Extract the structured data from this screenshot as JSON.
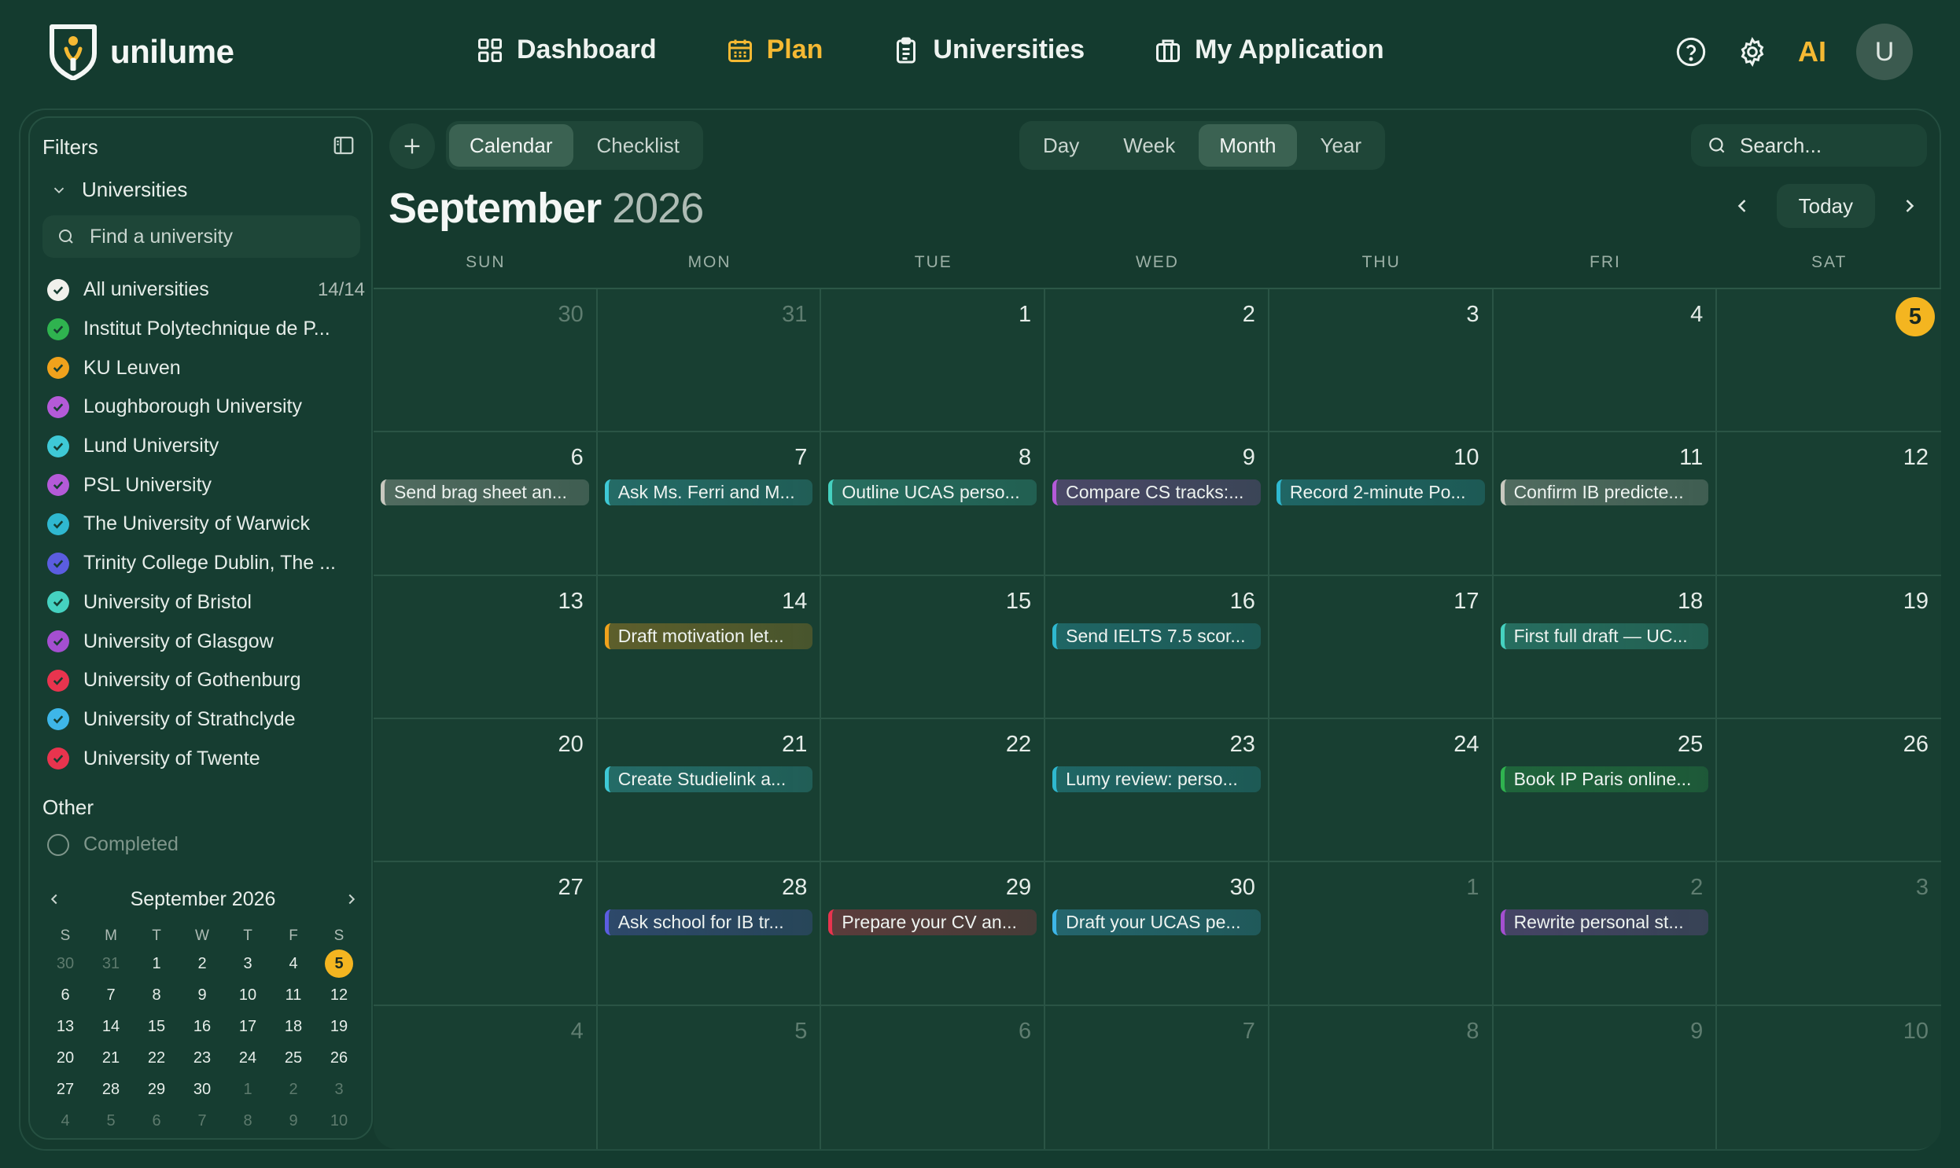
{
  "brand": {
    "name": "unilume",
    "accent": "#f5b933"
  },
  "nav": [
    {
      "label": "Dashboard",
      "icon": "dashboard-icon",
      "active": false
    },
    {
      "label": "Plan",
      "icon": "calendar-icon",
      "active": true
    },
    {
      "label": "Universities",
      "icon": "clipboard-icon",
      "active": false
    },
    {
      "label": "My Application",
      "icon": "briefcase-icon",
      "active": false
    }
  ],
  "top_right": {
    "ai_label": "AI",
    "avatar_initial": "U",
    "help_icon": "help-icon",
    "settings_icon": "gear-icon"
  },
  "sidebar": {
    "title": "Filters",
    "section": "Universities",
    "search_placeholder": "Find a university",
    "all": {
      "label": "All universities",
      "count": "14/14"
    },
    "universities": [
      {
        "name": "Institut Polytechnique de P...",
        "color": "#2fb34f"
      },
      {
        "name": "KU Leuven",
        "color": "#f0a21c"
      },
      {
        "name": "Loughborough University",
        "color": "#b45ad8"
      },
      {
        "name": "Lund University",
        "color": "#3ec9d6"
      },
      {
        "name": "PSL University",
        "color": "#b45ad8"
      },
      {
        "name": "The University of Warwick",
        "color": "#2fb8d0"
      },
      {
        "name": "Trinity College Dublin, The ...",
        "color": "#5b5de0"
      },
      {
        "name": "University of Bristol",
        "color": "#45d1c0"
      },
      {
        "name": "University of Glasgow",
        "color": "#a44fd0"
      },
      {
        "name": "University of Gothenburg",
        "color": "#e8344e"
      },
      {
        "name": "University of Strathclyde",
        "color": "#3eb6e8"
      },
      {
        "name": "University of Twente",
        "color": "#e8344e"
      }
    ],
    "other_title": "Other",
    "completed_label": "Completed",
    "mini_calendar": {
      "title": "September 2026",
      "dow": [
        "S",
        "M",
        "T",
        "W",
        "T",
        "F",
        "S"
      ],
      "weeks": [
        [
          "30",
          "31",
          "1",
          "2",
          "3",
          "4",
          "5"
        ],
        [
          "6",
          "7",
          "8",
          "9",
          "10",
          "11",
          "12"
        ],
        [
          "13",
          "14",
          "15",
          "16",
          "17",
          "18",
          "19"
        ],
        [
          "20",
          "21",
          "22",
          "23",
          "24",
          "25",
          "26"
        ],
        [
          "27",
          "28",
          "29",
          "30",
          "1",
          "2",
          "3"
        ],
        [
          "4",
          "5",
          "6",
          "7",
          "8",
          "9",
          "10"
        ]
      ],
      "today": "5"
    }
  },
  "toolbar": {
    "view_tabs": [
      {
        "label": "Calendar",
        "active": true
      },
      {
        "label": "Checklist",
        "active": false
      }
    ],
    "range_tabs": [
      {
        "label": "Day",
        "active": false
      },
      {
        "label": "Week",
        "active": false
      },
      {
        "label": "Month",
        "active": true
      },
      {
        "label": "Year",
        "active": false
      }
    ],
    "search_placeholder": "Search...",
    "today_label": "Today"
  },
  "calendar": {
    "month": "September",
    "year": "2026",
    "dow": [
      "SUN",
      "MON",
      "TUE",
      "WED",
      "THU",
      "FRI",
      "SAT"
    ],
    "days": [
      {
        "num": "30",
        "muted": true
      },
      {
        "num": "31",
        "muted": true
      },
      {
        "num": "1"
      },
      {
        "num": "2"
      },
      {
        "num": "3"
      },
      {
        "num": "4"
      },
      {
        "num": "5",
        "today": true
      },
      {
        "num": "6",
        "event": {
          "title": "Send brag sheet an...",
          "color": "#c9c9c0"
        }
      },
      {
        "num": "7",
        "event": {
          "title": "Ask Ms. Ferri and M...",
          "color": "#3ec9d6"
        }
      },
      {
        "num": "8",
        "event": {
          "title": "Outline UCAS perso...",
          "color": "#45d1c0"
        }
      },
      {
        "num": "9",
        "event": {
          "title": "Compare CS tracks:...",
          "color": "#b45ad8"
        }
      },
      {
        "num": "10",
        "event": {
          "title": "Record 2-minute Po...",
          "color": "#2fb8d0"
        }
      },
      {
        "num": "11",
        "event": {
          "title": "Confirm IB predicte...",
          "color": "#c9c9c0"
        }
      },
      {
        "num": "12"
      },
      {
        "num": "13"
      },
      {
        "num": "14",
        "event": {
          "title": "Draft motivation let...",
          "color": "#f0a21c"
        }
      },
      {
        "num": "15"
      },
      {
        "num": "16",
        "event": {
          "title": "Send IELTS 7.5 scor...",
          "color": "#2fb8d0"
        }
      },
      {
        "num": "17"
      },
      {
        "num": "18",
        "event": {
          "title": "First full draft — UC...",
          "color": "#45d1c0"
        }
      },
      {
        "num": "19"
      },
      {
        "num": "20"
      },
      {
        "num": "21",
        "event": {
          "title": "Create Studielink a...",
          "color": "#3ec9d6"
        }
      },
      {
        "num": "22"
      },
      {
        "num": "23",
        "event": {
          "title": "Lumy review: perso...",
          "color": "#2fb8d0"
        }
      },
      {
        "num": "24"
      },
      {
        "num": "25",
        "event": {
          "title": "Book IP Paris online...",
          "color": "#2fb34f"
        }
      },
      {
        "num": "26"
      },
      {
        "num": "27"
      },
      {
        "num": "28",
        "event": {
          "title": "Ask school for IB tr...",
          "color": "#5b5de0"
        }
      },
      {
        "num": "29",
        "event": {
          "title": "Prepare your CV an...",
          "color": "#e8344e"
        }
      },
      {
        "num": "30",
        "event": {
          "title": "Draft your UCAS pe...",
          "color": "#3eb6e8"
        }
      },
      {
        "num": "1",
        "muted": true
      },
      {
        "num": "2",
        "muted": true,
        "event": {
          "title": "Rewrite personal st...",
          "color": "#a44fd0"
        }
      },
      {
        "num": "3",
        "muted": true
      },
      {
        "num": "4",
        "muted": true
      },
      {
        "num": "5",
        "muted": true
      },
      {
        "num": "6",
        "muted": true
      },
      {
        "num": "7",
        "muted": true
      },
      {
        "num": "8",
        "muted": true
      },
      {
        "num": "9",
        "muted": true
      },
      {
        "num": "10",
        "muted": true
      }
    ]
  }
}
